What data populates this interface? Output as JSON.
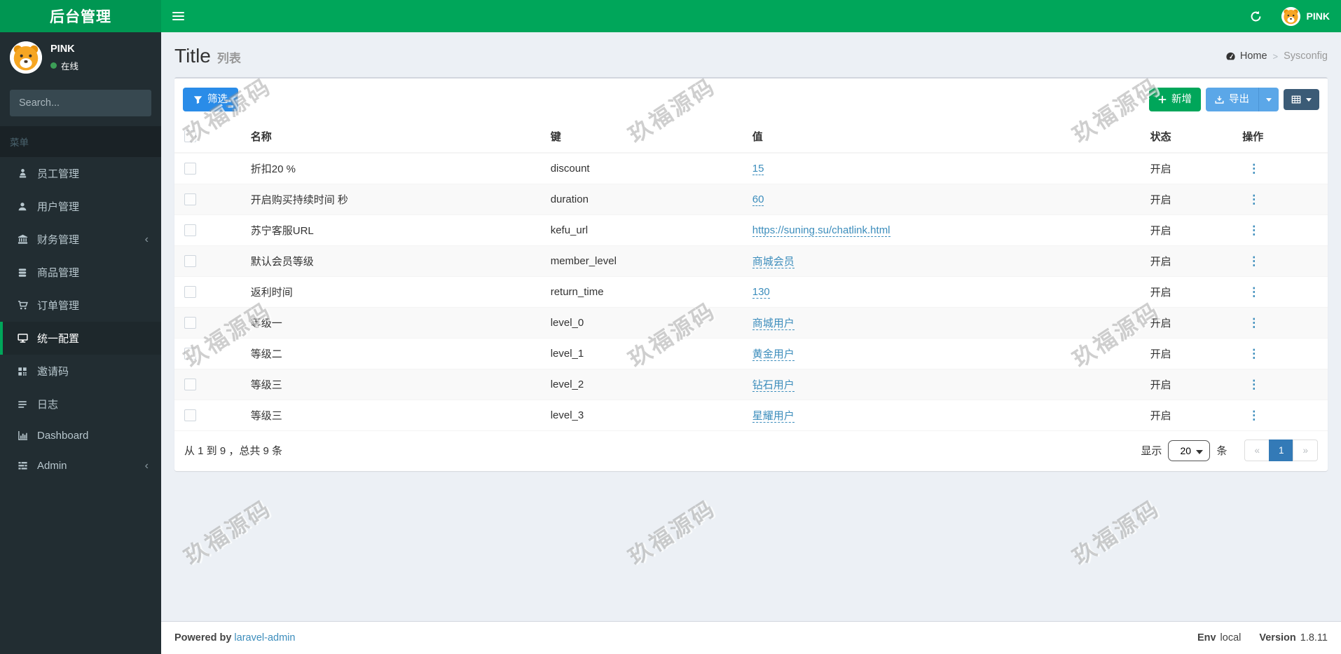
{
  "navbar": {
    "logo": "后台管理",
    "user": "PINK"
  },
  "sidebar": {
    "user": {
      "name": "PINK",
      "status": "在线"
    },
    "search_placeholder": "Search...",
    "menu_header": "菜单",
    "items": [
      {
        "id": "staff",
        "label": "员工管理",
        "icon": "employee-icon",
        "active": false,
        "chevron": false
      },
      {
        "id": "users",
        "label": "用户管理",
        "icon": "user-icon",
        "active": false,
        "chevron": false
      },
      {
        "id": "finance",
        "label": "财务管理",
        "icon": "bank-icon",
        "active": false,
        "chevron": true
      },
      {
        "id": "goods",
        "label": "商品管理",
        "icon": "database-icon",
        "active": false,
        "chevron": false
      },
      {
        "id": "orders",
        "label": "订单管理",
        "icon": "cart-icon",
        "active": false,
        "chevron": false
      },
      {
        "id": "config",
        "label": "统一配置",
        "icon": "desktop-icon",
        "active": true,
        "chevron": false
      },
      {
        "id": "invite",
        "label": "邀请码",
        "icon": "qrcode-icon",
        "active": false,
        "chevron": false
      },
      {
        "id": "logs",
        "label": "日志",
        "icon": "lines-icon",
        "active": false,
        "chevron": false
      },
      {
        "id": "dashboard",
        "label": "Dashboard",
        "icon": "bar-chart-icon",
        "active": false,
        "chevron": false
      },
      {
        "id": "admin",
        "label": "Admin",
        "icon": "tasks-icon",
        "active": false,
        "chevron": true
      }
    ]
  },
  "page": {
    "title": "Title",
    "subtitle": "列表",
    "breadcrumb": {
      "home": "Home",
      "current": "Sysconfig"
    }
  },
  "toolbar": {
    "filter": "筛选",
    "add": "新增",
    "export": "导出"
  },
  "table": {
    "headers": [
      "名称",
      "键",
      "值",
      "状态",
      "操作"
    ],
    "rows": [
      {
        "name": "折扣20 %",
        "key": "discount",
        "value": "15",
        "status": "开启"
      },
      {
        "name": "开启购买持续时间 秒",
        "key": "duration",
        "value": "60",
        "status": "开启"
      },
      {
        "name": "苏宁客服URL",
        "key": "kefu_url",
        "value": "https://suning.su/chatlink.html",
        "status": "开启"
      },
      {
        "name": "默认会员等级",
        "key": "member_level",
        "value": "商城会员",
        "status": "开启"
      },
      {
        "name": "返利时间",
        "key": "return_time",
        "value": "130",
        "status": "开启"
      },
      {
        "name": "等级一",
        "key": "level_0",
        "value": "商城用户",
        "status": "开启"
      },
      {
        "name": "等级二",
        "key": "level_1",
        "value": "黄金用户",
        "status": "开启"
      },
      {
        "name": "等级三",
        "key": "level_2",
        "value": "钻石用户",
        "status": "开启"
      },
      {
        "name": "等级三",
        "key": "level_3",
        "value": "星耀用户",
        "status": "开启"
      }
    ],
    "action_glyph": "⋮",
    "summary": "从 1 到 9 ，总共 9 条",
    "per_page_prefix": "显示",
    "page_size": "20",
    "per_page_suffix": "条",
    "pager": {
      "prev": "«",
      "page": "1",
      "next": "»"
    }
  },
  "footer": {
    "powered_by": "Powered by",
    "powered_link": "laravel-admin",
    "env_label": "Env",
    "env_value": "local",
    "version_label": "Version",
    "version_value": "1.8.11"
  },
  "watermark": "玖福源码",
  "colors": {
    "navbar_green": "#00a65a",
    "logo_green": "#009652",
    "sidebar_dark": "#222d32",
    "content_bg": "#ecf0f5",
    "filter_blue": "#2a8ce8",
    "export_blue": "#5ba7e8",
    "grid_navy": "#3b5b76",
    "link_blue": "#3c8dbc",
    "active_page_blue": "#337ab7"
  }
}
